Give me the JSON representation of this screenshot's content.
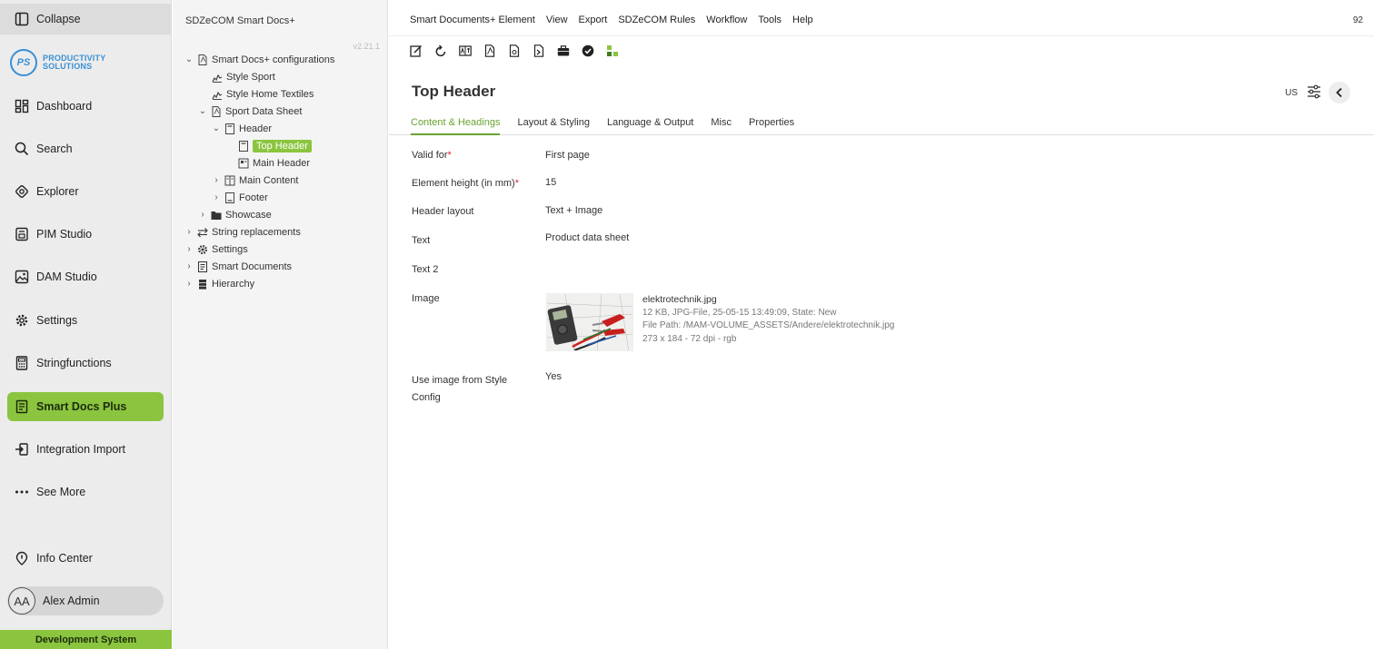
{
  "leftnav": {
    "collapse": "Collapse",
    "logo": {
      "initials": "PS",
      "line1": "PRODUCTIVITY",
      "line2": "SOLUTIONS"
    },
    "items": [
      {
        "label": "Dashboard",
        "icon": "dashboard-icon"
      },
      {
        "label": "Search",
        "icon": "search-icon"
      },
      {
        "label": "Explorer",
        "icon": "explorer-icon"
      },
      {
        "label": "PIM Studio",
        "icon": "pim-studio-icon"
      },
      {
        "label": "DAM Studio",
        "icon": "image-icon"
      },
      {
        "label": "Settings",
        "icon": "gear-icon"
      },
      {
        "label": "Stringfunctions",
        "icon": "calculator-icon"
      },
      {
        "label": "Smart Docs Plus",
        "icon": "document-icon",
        "active": true
      },
      {
        "label": "Integration Import",
        "icon": "import-icon"
      },
      {
        "label": "See More",
        "icon": "more-icon"
      }
    ],
    "info_center": "Info Center",
    "user": {
      "initials": "AA",
      "name": "Alex Admin"
    },
    "environment": "Development System"
  },
  "tree": {
    "title": "SDZeCOM Smart Docs+",
    "version": "v2.21.1",
    "nodes": [
      {
        "label": "Smart Docs+ configurations"
      },
      {
        "label": "Style Sport"
      },
      {
        "label": "Style Home Textiles"
      },
      {
        "label": "Sport Data Sheet"
      },
      {
        "label": "Header"
      },
      {
        "label": "Top Header",
        "selected": true
      },
      {
        "label": "Main Header"
      },
      {
        "label": "Main Content"
      },
      {
        "label": "Footer"
      },
      {
        "label": "Showcase"
      },
      {
        "label": "String replacements"
      },
      {
        "label": "Settings"
      },
      {
        "label": "Smart Documents"
      },
      {
        "label": "Hierarchy"
      }
    ]
  },
  "menubar": {
    "items": [
      "Smart Documents+ Element",
      "View",
      "Export",
      "SDZeCOM Rules",
      "Workflow",
      "Tools",
      "Help"
    ],
    "page_number": "92"
  },
  "toolbar": {
    "buttons": [
      "edit-icon",
      "reload-icon",
      "translate-icon",
      "pdf-icon",
      "preview-icon",
      "export-icon",
      "briefcase-icon",
      "check-circle-icon",
      "tree-icon"
    ]
  },
  "editor": {
    "title": "Top Header",
    "language": "US",
    "tabs": [
      "Content & Headings",
      "Layout & Styling",
      "Language & Output",
      "Misc",
      "Properties"
    ],
    "fields": {
      "valid_for": {
        "label": "Valid for",
        "value": "First page"
      },
      "element_height": {
        "label": "Element height (in mm)",
        "value": "15"
      },
      "header_layout": {
        "label": "Header layout",
        "value": "Text + Image"
      },
      "text": {
        "label": "Text",
        "value": "Product data sheet"
      },
      "text2": {
        "label": "Text 2",
        "value": ""
      },
      "image": {
        "label": "Image"
      },
      "use_image": {
        "label_line1": "Use image from Style",
        "label_line2": "Config",
        "value": "Yes"
      }
    },
    "image": {
      "filename": "elektrotechnik.jpg",
      "meta": "12 KB, JPG-File, 25-05-15 13:49:09, State: New",
      "path": "File Path: /MAM-VOLUME_ASSETS/Andere/elektrotechnik.jpg",
      "dims": "273 x 184 - 72 dpi - rgb"
    }
  },
  "colors": {
    "accent": "#8bc53f",
    "tab_active": "#6aa42f",
    "logo": "#3a8fd4"
  }
}
